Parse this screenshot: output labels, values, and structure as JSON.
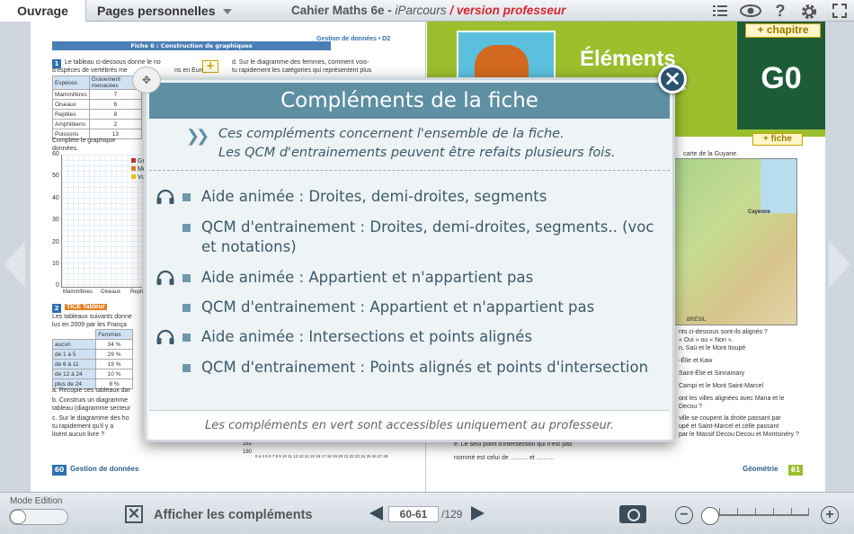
{
  "topbar": {
    "tab_ouvrage": "Ouvrage",
    "tab_pages": "Pages personnelles",
    "title_main": "Cahier Maths 6e - ",
    "title_iparcours": "iParcours",
    "title_sep": " / ",
    "title_version": "version professeur",
    "icons": [
      "list-icon",
      "eye-icon",
      "help-icon",
      "gear-icon",
      "fullscreen-icon"
    ]
  },
  "left_page": {
    "header_right": "Gestion de données • D2",
    "fiche_title": "Fiche 6 : Construction de graphiques",
    "q1_num": "1",
    "q1_text": "Le tableau ci-dessous donne le no",
    "q1_text2": "d'espèces de vertébrés me",
    "q1_text3": "ns en Europe.",
    "q1_right": "d. Sur le diagramme des femmes, comment vois-",
    "q1_right2": "tu rapidement les catégories qui représentent plus",
    "table1_headers": [
      "Espèces",
      "Gravement menacées"
    ],
    "table1_rows": [
      [
        "Mammifères",
        "7"
      ],
      [
        "Oiseaux",
        "6"
      ],
      [
        "Reptiles",
        "8"
      ],
      [
        "Amphibiens",
        "2"
      ],
      [
        "Poissons",
        "13"
      ]
    ],
    "complete_text": "Complète le graphique",
    "complete_text2": "données.",
    "y_ticks": [
      "60",
      "50",
      "40",
      "30",
      "20",
      "10",
      "0"
    ],
    "legend": [
      "Gr",
      "Me",
      "Vu"
    ],
    "x_labels": [
      "Mammifères",
      "Oiseaux",
      "Repti"
    ],
    "q2_num": "2",
    "q2_title": "TICE Tableur",
    "q2_text": "Les tableaux suivants donne",
    "q2_text2": "lus en 2009 par les França",
    "table2_header": "Femmes",
    "table2_rows": [
      [
        "aucun",
        "34 %"
      ],
      [
        "de 1 à 5",
        "29 %"
      ],
      [
        "de 6 à 11",
        "19 %"
      ],
      [
        "de 12 à 24",
        "10 %"
      ],
      [
        "plus de 24",
        "8 %"
      ]
    ],
    "qa": "a. Recopie ces tableaux dar",
    "qb": "b. Construis un diagramme",
    "qb2": "tableau (diagramme secteur",
    "qc": "c. Sur le diagramme des ho",
    "qc2": "tu rapidement qu'il y a",
    "qc3": "lisent aucun livre ?",
    "lower_ticks": [
      "181",
      "180"
    ],
    "lower_x": "0 à 4 5 6 7 8 9 10 11 12 13 14 15 16 17 18 19 20 21 22 23 24 25 26 27 28",
    "footer_num": "60",
    "footer_label": "Gestion de données"
  },
  "right_page": {
    "title_line1": "Éléments",
    "title_line2": "rie",
    "chapter_button": "+ chapitre",
    "chapter_code": "G0",
    "fiche_button": "+ fiche",
    "map_caption": "carte de la Guyane.",
    "map_label": "Cayenne",
    "map_label2": "BRÉSIL",
    "questions": [
      "nts ci-dessous sont-ils alignés ?",
      "« Oui » ou « Non ».",
      "n, Saü et le Mont Itoupé",
      "-Élie et Kaw",
      "Saint-Élie et Sinnamary",
      "Campi et le Mont Saint-Marcel",
      "ont les villes alignées avec Mana et le",
      "Decou ?",
      "ville se coupent la droite passant par",
      "upé et Saint-Marcel et celle passant",
      "par le Massif Decou Decou et Montsinéry ?"
    ],
    "q_e": "e. Le seul point d'intersection qui n'est pas",
    "q_e2": "nommé est celui de .......... et ..........",
    "footer_label": "Géométrie",
    "footer_num": "61"
  },
  "modal": {
    "title": "Compléments de la fiche",
    "intro_line1": "Ces compléments concernent l'ensemble de la fiche.",
    "intro_line2": "Les QCM d'entrainements peuvent être refaits plusieurs fois.",
    "items": [
      {
        "text": "Aide animée : Droites, demi-droites, segments",
        "audio": true
      },
      {
        "text": "QCM d'entrainement : Droites, demi-droites, segments.. (voc et notations)",
        "audio": false
      },
      {
        "text": "Aide animée : Appartient et n'appartient pas",
        "audio": true
      },
      {
        "text": "QCM d'entrainement : Appartient et n'appartient pas",
        "audio": false
      },
      {
        "text": "Aide animée : Intersections et points alignés",
        "audio": true
      },
      {
        "text": "QCM d'entrainement : Points alignés et points d'intersection",
        "audio": false
      }
    ],
    "footer": "Les compléments en vert sont accessibles uniquement au professeur.",
    "close": "×"
  },
  "bottombar": {
    "mode_label": "Mode Edition",
    "show_label": "Afficher les compléments",
    "page_value": "60-61",
    "page_total": "/129",
    "zoom_minus": "−",
    "zoom_plus": "+"
  },
  "colors": {
    "modal_header": "#5f8fa3",
    "green_accent": "#9bbf2d",
    "dark_green": "#1e5c38",
    "version_red": "#d7262f",
    "close_button": "#2b5270"
  }
}
